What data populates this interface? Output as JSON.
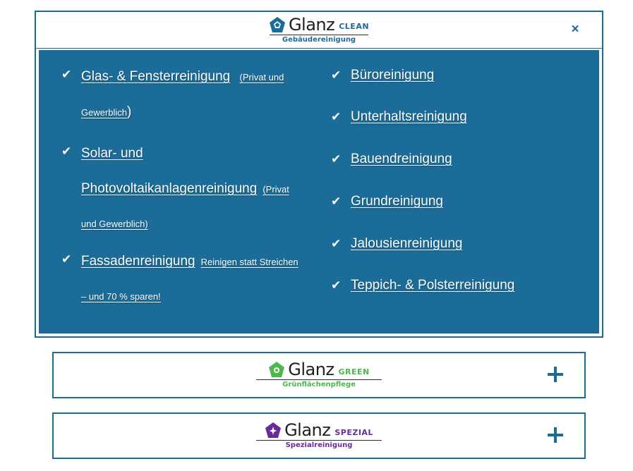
{
  "colors": {
    "primary": "#1b6c98",
    "green_accent": "#4cb84b",
    "spezial_accent": "#6a2b9a",
    "text_on_primary": "#ffffff"
  },
  "panels": {
    "clean": {
      "brand": "Glanz",
      "tag": "CLEAN",
      "subtitle": "Gebäudereinigung",
      "close_symbol": "×",
      "left_items": [
        {
          "title": "Glas- & Fensterreinigung",
          "note": "(Privat und",
          "note_cont": "Gewerblich",
          "tail": ")"
        },
        {
          "title": "Solar- und",
          "title_cont": "Photovoltaikanlagenreinigung",
          "note": "(Privat",
          "note_cont": "und Gewerblich)"
        },
        {
          "title": "Fassadenreinigung",
          "note": "Reinigen statt Streichen",
          "note_cont": "– und 70 % sparen!"
        }
      ],
      "right_items": [
        {
          "title": "Büroreinigung"
        },
        {
          "title": "Unterhaltsreinigung"
        },
        {
          "title": "Bauendreinigung"
        },
        {
          "title": "Grundreinigung"
        },
        {
          "title": "Jalousienreinigung"
        },
        {
          "title": "Teppich- & Polsterreinigung"
        }
      ]
    },
    "green": {
      "brand": "Glanz",
      "tag": "GREEN",
      "subtitle": "Grünflächenpflege"
    },
    "spezial": {
      "brand": "Glanz",
      "tag": "SPEZIAL",
      "subtitle": "Spezialreinigung"
    }
  }
}
